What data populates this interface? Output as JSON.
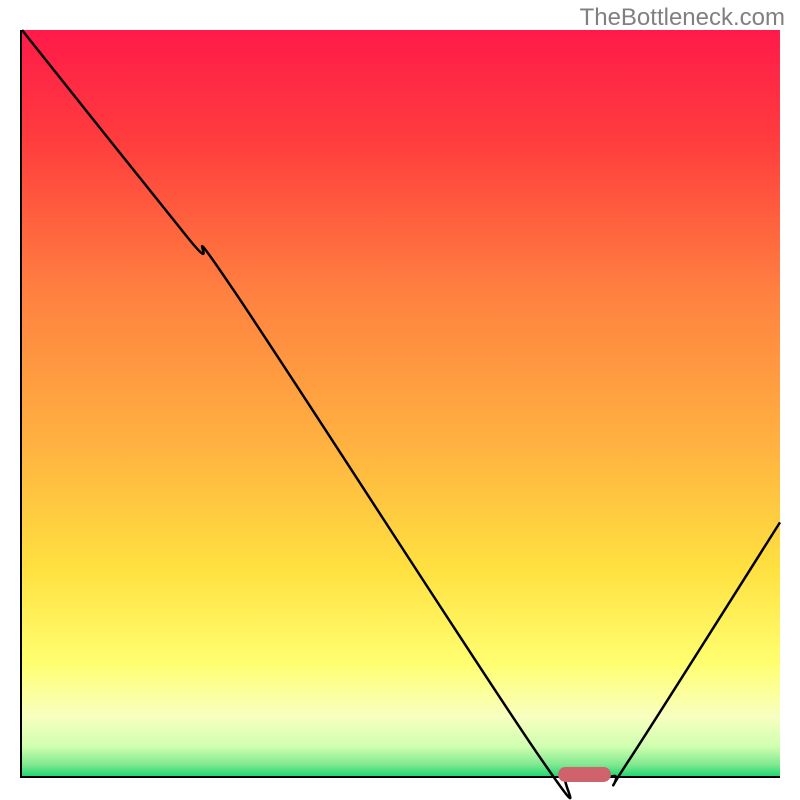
{
  "watermark": "TheBottleneck.com",
  "chart_data": {
    "type": "line",
    "title": "",
    "xlabel": "",
    "ylabel": "",
    "xlim": [
      0,
      100
    ],
    "ylim": [
      0,
      100
    ],
    "curve_points": [
      {
        "x": 0,
        "y": 100
      },
      {
        "x": 22,
        "y": 72
      },
      {
        "x": 28,
        "y": 65
      },
      {
        "x": 68,
        "y": 3
      },
      {
        "x": 72,
        "y": 0
      },
      {
        "x": 78,
        "y": 0
      },
      {
        "x": 80,
        "y": 2
      },
      {
        "x": 100,
        "y": 34
      }
    ],
    "marker": {
      "x": 74,
      "y": 0.5,
      "width": 7,
      "height": 2,
      "color": "#d0626c"
    },
    "gradient_stops": [
      {
        "offset": 0,
        "color": "#ff1a4a"
      },
      {
        "offset": 0.15,
        "color": "#ff3d3d"
      },
      {
        "offset": 0.35,
        "color": "#ff8040"
      },
      {
        "offset": 0.55,
        "color": "#ffb040"
      },
      {
        "offset": 0.72,
        "color": "#ffe040"
      },
      {
        "offset": 0.85,
        "color": "#ffff70"
      },
      {
        "offset": 0.92,
        "color": "#f8ffc0"
      },
      {
        "offset": 0.96,
        "color": "#d0ffb0"
      },
      {
        "offset": 0.985,
        "color": "#80e890"
      },
      {
        "offset": 1.0,
        "color": "#20d870"
      }
    ]
  }
}
